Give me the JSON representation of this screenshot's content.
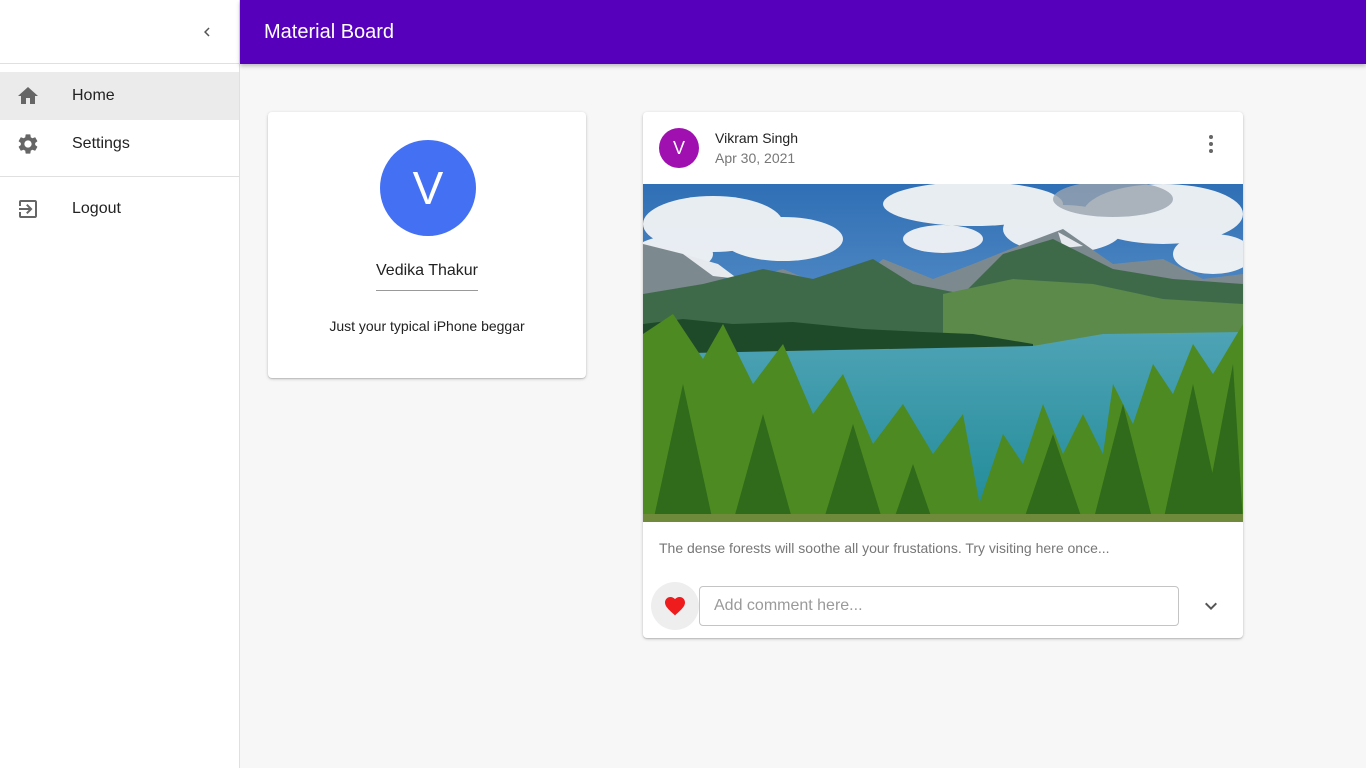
{
  "app": {
    "title": "Material Board"
  },
  "sidebar": {
    "collapse_icon": "chevron-left-icon",
    "items": [
      {
        "label": "Home",
        "icon": "home-icon",
        "active": true
      },
      {
        "label": "Settings",
        "icon": "gear-icon",
        "active": false
      }
    ],
    "footer_items": [
      {
        "label": "Logout",
        "icon": "logout-icon"
      }
    ]
  },
  "profile": {
    "avatar_letter": "V",
    "name": "Vedika Thakur",
    "bio": "Just your typical iPhone beggar"
  },
  "post": {
    "avatar_letter": "V",
    "author": "Vikram Singh",
    "date": "Apr 30, 2021",
    "image_alt": "mountain lake forest landscape",
    "caption": "The dense forests will soothe all your frustations. Try visiting here once...",
    "liked": true,
    "comment_placeholder": "Add comment here...",
    "comment_value": ""
  },
  "colors": {
    "appbar": "#5600bb",
    "profile_avatar": "#4470f4",
    "post_avatar": "#a010b0",
    "like": "#ee1c1c"
  }
}
